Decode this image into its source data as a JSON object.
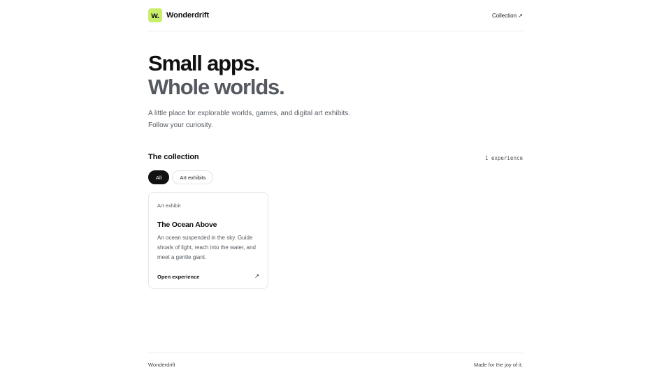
{
  "header": {
    "logo_text": "w.",
    "brand": "Wonderdrift",
    "nav_link": "Collection ↗"
  },
  "hero": {
    "line1": "Small apps.",
    "line2": "Whole worlds.",
    "lede_line1": "A little place for explorable worlds, games, and digital art exhibits.",
    "lede_line2": "Follow your curiosity."
  },
  "collection": {
    "title": "The collection",
    "count": "1 experience",
    "filters": [
      {
        "label": "All",
        "active": true
      },
      {
        "label": "Art exhibits",
        "active": false
      }
    ],
    "cards": [
      {
        "tag": "Art exhibit",
        "title": "The Ocean Above",
        "description": "An ocean suspended in the sky. Guide shoals of light, reach into the water, and meet a gentle giant.",
        "cta": "Open experience",
        "arrow": "↗"
      }
    ]
  },
  "footer": {
    "left": "Wonderdrift",
    "right": "Made for the joy of it."
  },
  "colors": {
    "accent": "#c9ee6c",
    "text": "#111111",
    "muted": "#555a61"
  }
}
